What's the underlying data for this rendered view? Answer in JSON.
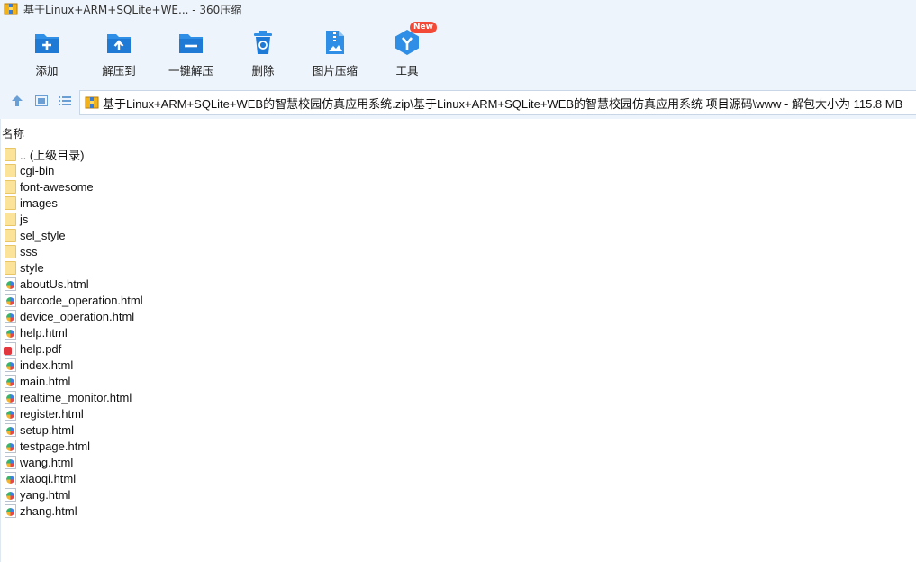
{
  "window": {
    "title": "基于Linux+ARM+SQLite+WE... - 360压缩"
  },
  "toolbar": {
    "items": [
      {
        "label": "添加",
        "icon": "add-icon"
      },
      {
        "label": "解压到",
        "icon": "extract-to-icon"
      },
      {
        "label": "一键解压",
        "icon": "one-click-extract-icon"
      },
      {
        "label": "删除",
        "icon": "delete-icon"
      },
      {
        "label": "图片压缩",
        "icon": "image-compress-icon"
      },
      {
        "label": "工具",
        "icon": "tools-icon",
        "badge": "New"
      }
    ]
  },
  "nav": {
    "path": "基于Linux+ARM+SQLite+WEB的智慧校园仿真应用系统.zip\\基于Linux+ARM+SQLite+WEB的智慧校园仿真应用系统  项目源码\\www - 解包大小为 115.8 MB"
  },
  "filelist": {
    "column_name": "名称",
    "rows": [
      {
        "name": ".. (上级目录)",
        "type": "folder"
      },
      {
        "name": "cgi-bin",
        "type": "folder"
      },
      {
        "name": "font-awesome",
        "type": "folder"
      },
      {
        "name": "images",
        "type": "folder"
      },
      {
        "name": "js",
        "type": "folder"
      },
      {
        "name": "sel_style",
        "type": "folder"
      },
      {
        "name": "sss",
        "type": "folder"
      },
      {
        "name": "style",
        "type": "folder"
      },
      {
        "name": "aboutUs.html",
        "type": "html"
      },
      {
        "name": "barcode_operation.html",
        "type": "html"
      },
      {
        "name": "device_operation.html",
        "type": "html"
      },
      {
        "name": "help.html",
        "type": "html"
      },
      {
        "name": "help.pdf",
        "type": "pdf"
      },
      {
        "name": "index.html",
        "type": "html"
      },
      {
        "name": "main.html",
        "type": "html"
      },
      {
        "name": "realtime_monitor.html",
        "type": "html"
      },
      {
        "name": "register.html",
        "type": "html"
      },
      {
        "name": "setup.html",
        "type": "html"
      },
      {
        "name": "testpage.html",
        "type": "html"
      },
      {
        "name": "wang.html",
        "type": "html"
      },
      {
        "name": "xiaoqi.html",
        "type": "html"
      },
      {
        "name": "yang.html",
        "type": "html"
      },
      {
        "name": "zhang.html",
        "type": "html"
      }
    ]
  },
  "colors": {
    "accent": "#2f8ee6",
    "toolbar_bg": "#eef4fb",
    "folder": "#fbe49a",
    "badge": "#f24a37"
  }
}
